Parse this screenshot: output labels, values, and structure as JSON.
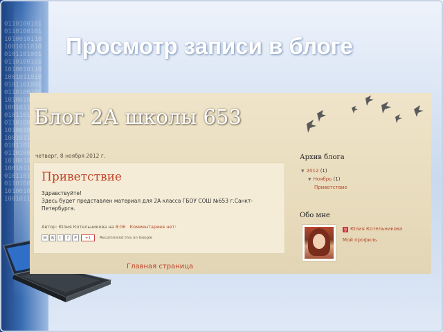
{
  "slide": {
    "title": "Просмотр записи в блоге"
  },
  "blog": {
    "title": "Блог 2А школы 653",
    "post": {
      "date": "четверг, 8 ноября 2012 г.",
      "title": "Приветствие",
      "body_line1": "Здравствуйте!",
      "body_line2": "Здесь будет представлен материал для 2А класса ГБОУ СОШ №653 г.Санкт-Петербурга.",
      "meta_author_prefix": "Автор: Юлия Котельникова на ",
      "meta_time": "8:06",
      "meta_comments": "Комментариев нет:",
      "share_icons": [
        "M",
        "B",
        "t",
        "f",
        "P"
      ],
      "gplus_label": "+1",
      "recommend_text": "Recommend this on Google"
    },
    "home_link": "Главная страница",
    "sidebar": {
      "archive_heading": "Архив блога",
      "archive_year": "2012",
      "archive_year_count": "(1)",
      "archive_month": "Ноябрь",
      "archive_month_count": "(1)",
      "archive_post": "Приветствие",
      "about_heading": "Обо мне",
      "author_name": "Юлия Котельникова",
      "profile_link": "Мой профиль"
    }
  },
  "colors": {
    "accent": "#c2432a",
    "blog_bg": "#e8dcbd",
    "slide_title": "#ffffff"
  }
}
